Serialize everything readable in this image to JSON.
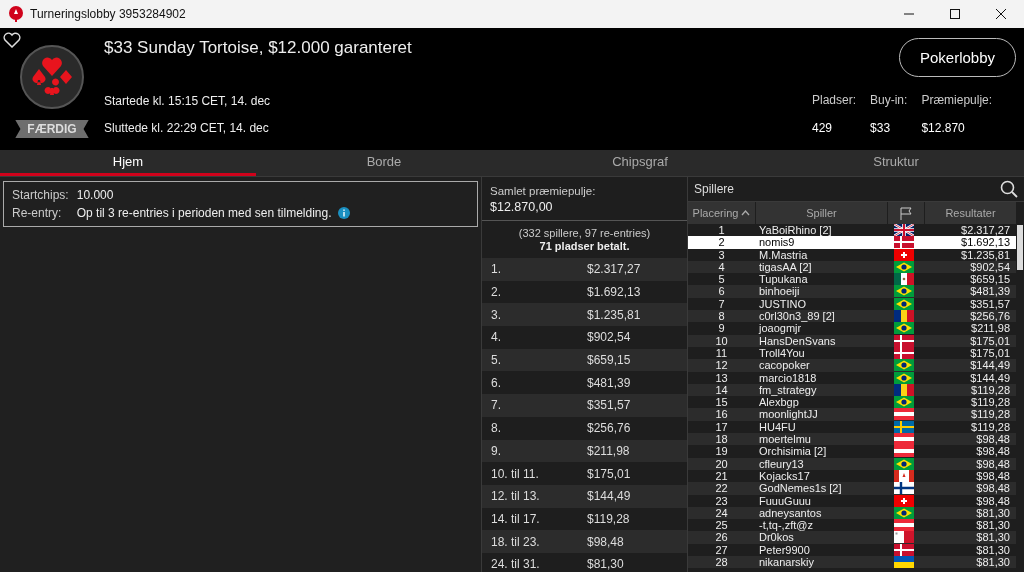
{
  "window": {
    "title": "Turneringslobby 3953284902"
  },
  "header": {
    "title": "$33 Sunday Tortoise, $12.000 garanteret",
    "status": "FÆRDIG",
    "favorite": false,
    "started": "Startede kl. 15:15 CET, 14. dec",
    "ended": "Sluttede kl. 22:29 CET, 14. dec",
    "lobby_button": "Pokerlobby",
    "stats": [
      {
        "label": "Pladser:",
        "value": "429"
      },
      {
        "label": "Buy-in:",
        "value": "$33"
      },
      {
        "label": "Præmiepulje:",
        "value": "$12.870"
      }
    ]
  },
  "tabs": [
    {
      "label": "Hjem",
      "selected": true
    },
    {
      "label": "Borde",
      "selected": false
    },
    {
      "label": "Chipsgraf",
      "selected": false
    },
    {
      "label": "Struktur",
      "selected": false
    }
  ],
  "info": [
    {
      "label": "Startchips:",
      "value": "10.000",
      "info": false
    },
    {
      "label": "Re-entry:",
      "value": "Op til 3 re-entries i perioden med sen tilmelding.",
      "info": true
    }
  ],
  "prizes": {
    "title": "Samlet præmiepulje:",
    "total": "$12.870,00",
    "summary": "(332 spillere, 97 re-entries)",
    "paid": "71 pladser betalt.",
    "rows": [
      {
        "place": "1.",
        "amount": "$2.317,27"
      },
      {
        "place": "2.",
        "amount": "$1.692,13"
      },
      {
        "place": "3.",
        "amount": "$1.235,81"
      },
      {
        "place": "4.",
        "amount": "$902,54"
      },
      {
        "place": "5.",
        "amount": "$659,15"
      },
      {
        "place": "6.",
        "amount": "$481,39"
      },
      {
        "place": "7.",
        "amount": "$351,57"
      },
      {
        "place": "8.",
        "amount": "$256,76"
      },
      {
        "place": "9.",
        "amount": "$211,98"
      },
      {
        "place": "10. til 11.",
        "amount": "$175,01"
      },
      {
        "place": "12. til 13.",
        "amount": "$144,49"
      },
      {
        "place": "14. til 17.",
        "amount": "$119,28"
      },
      {
        "place": "18. til 23.",
        "amount": "$98,48"
      },
      {
        "place": "24. til 31.",
        "amount": "$81,30"
      }
    ]
  },
  "players": {
    "title": "Spillere",
    "columns": [
      "Placering",
      "Spiller",
      "Resultater"
    ],
    "rows": [
      {
        "rank": "1",
        "name": "YaBoiRhino [2]",
        "kind": "gb",
        "result": "$2.317,27",
        "selected": false
      },
      {
        "rank": "2",
        "name": "nomis9",
        "kind": "dk",
        "result": "$1.692,13",
        "selected": true
      },
      {
        "rank": "3",
        "name": "M.Mastria",
        "kind": "ch",
        "result": "$1.235,81",
        "selected": false
      },
      {
        "rank": "4",
        "name": "tigasAA [2]",
        "kind": "br",
        "result": "$902,54",
        "selected": false
      },
      {
        "rank": "5",
        "name": "Tupukana",
        "kind": "mx",
        "result": "$659,15",
        "selected": false
      },
      {
        "rank": "6",
        "name": "binhoeiji",
        "kind": "br",
        "result": "$481,39",
        "selected": false
      },
      {
        "rank": "7",
        "name": "JUSTINO",
        "kind": "br",
        "result": "$351,57",
        "selected": false
      },
      {
        "rank": "8",
        "name": "c0rl30n3_89 [2]",
        "kind": "ro",
        "result": "$256,76",
        "selected": false
      },
      {
        "rank": "9",
        "name": "joaogmjr",
        "kind": "br",
        "result": "$211,98",
        "selected": false
      },
      {
        "rank": "10",
        "name": "HansDenSvans",
        "kind": "dk",
        "result": "$175,01",
        "selected": false
      },
      {
        "rank": "11",
        "name": "Troll4You",
        "kind": "dk",
        "result": "$175,01",
        "selected": false
      },
      {
        "rank": "12",
        "name": "cacopoker",
        "kind": "br",
        "result": "$144,49",
        "selected": false
      },
      {
        "rank": "13",
        "name": "marcio1818",
        "kind": "br",
        "result": "$144,49",
        "selected": false
      },
      {
        "rank": "14",
        "name": "fm_strategy",
        "kind": "ro",
        "result": "$119,28",
        "selected": false
      },
      {
        "rank": "15",
        "name": "Alexbgp",
        "kind": "br",
        "result": "$119,28",
        "selected": false
      },
      {
        "rank": "16",
        "name": "moonlightJJ",
        "kind": "at",
        "result": "$119,28",
        "selected": false
      },
      {
        "rank": "17",
        "name": "HU4FU",
        "kind": "se",
        "result": "$119,28",
        "selected": false
      },
      {
        "rank": "18",
        "name": "moertelmu",
        "kind": "at",
        "result": "$98,48",
        "selected": false
      },
      {
        "rank": "19",
        "name": "Orchisimia [2]",
        "kind": "at",
        "result": "$98,48",
        "selected": false
      },
      {
        "rank": "20",
        "name": "cfleury13",
        "kind": "br",
        "result": "$98,48",
        "selected": false
      },
      {
        "rank": "21",
        "name": "Kojacks17",
        "kind": "ca",
        "result": "$98,48",
        "selected": false
      },
      {
        "rank": "22",
        "name": "GodNemes1s [2]",
        "kind": "fi",
        "result": "$98,48",
        "selected": false
      },
      {
        "rank": "23",
        "name": "FuuuGuuu",
        "kind": "ch",
        "result": "$98,48",
        "selected": false
      },
      {
        "rank": "24",
        "name": "adneysantos",
        "kind": "br",
        "result": "$81,30",
        "selected": false
      },
      {
        "rank": "25",
        "name": "-t,tq-,zft@z",
        "kind": "at",
        "result": "$81,30",
        "selected": false
      },
      {
        "rank": "26",
        "name": "Dr0kos",
        "kind": "mt",
        "result": "$81,30",
        "selected": false
      },
      {
        "rank": "27",
        "name": "Peter9900",
        "kind": "dk",
        "result": "$81,30",
        "selected": false
      },
      {
        "rank": "28",
        "name": "nikanarskiy",
        "kind": "ua",
        "result": "$81,30",
        "selected": false
      }
    ]
  }
}
